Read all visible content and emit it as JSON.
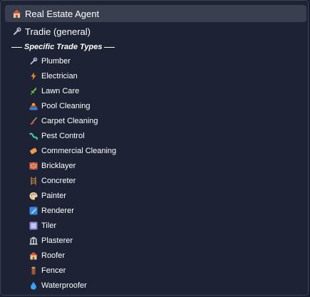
{
  "options": [
    {
      "label": "Real Estate Agent",
      "icon": "house-icon",
      "selected": true
    },
    {
      "label": "Tradie (general)",
      "icon": "wrench-icon",
      "selected": false
    }
  ],
  "group": {
    "label": "Specific Trade Types",
    "items": [
      {
        "label": "Plumber",
        "icon": "wrench-icon"
      },
      {
        "label": "Electrician",
        "icon": "lightning-icon"
      },
      {
        "label": "Lawn Care",
        "icon": "herb-icon"
      },
      {
        "label": "Pool Cleaning",
        "icon": "swimmer-icon"
      },
      {
        "label": "Carpet Cleaning",
        "icon": "broom-icon"
      },
      {
        "label": "Pest Control",
        "icon": "bug-icon"
      },
      {
        "label": "Commercial Cleaning",
        "icon": "soap-icon"
      },
      {
        "label": "Bricklayer",
        "icon": "bricks-icon"
      },
      {
        "label": "Concreter",
        "icon": "ladder-icon"
      },
      {
        "label": "Painter",
        "icon": "palette-icon"
      },
      {
        "label": "Renderer",
        "icon": "trowel-icon"
      },
      {
        "label": "Tiler",
        "icon": "tile-icon"
      },
      {
        "label": "Plasterer",
        "icon": "building-icon"
      },
      {
        "label": "Roofer",
        "icon": "house-icon"
      },
      {
        "label": "Fencer",
        "icon": "wood-icon"
      },
      {
        "label": "Waterproofer",
        "icon": "droplet-icon"
      }
    ]
  },
  "colors": {
    "background": "#1d2335",
    "selected": "#3a3f50",
    "text": "#ffffff"
  }
}
